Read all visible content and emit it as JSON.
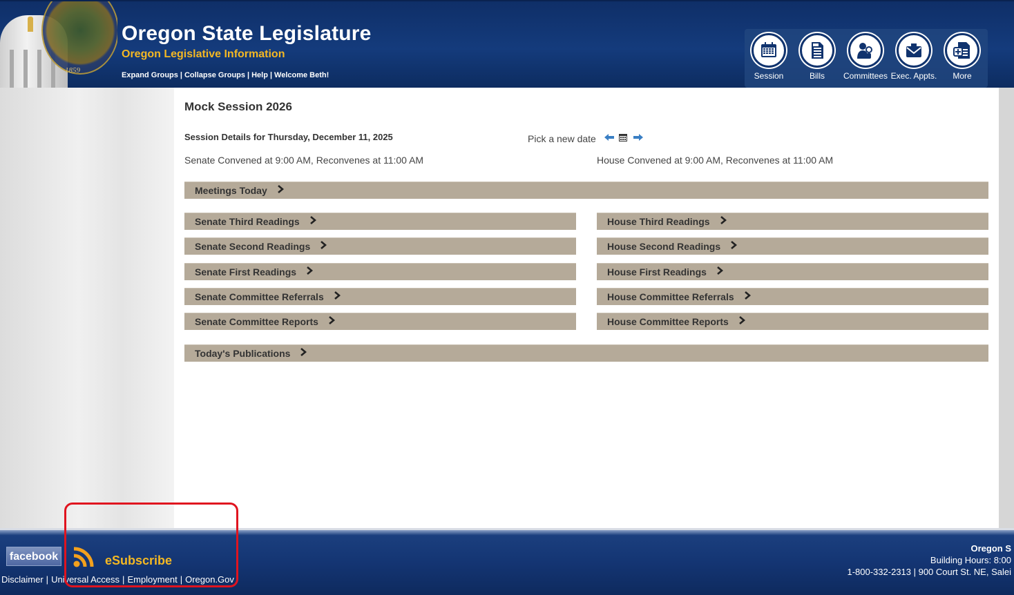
{
  "header": {
    "title": "Oregon State Legislature",
    "subtitle": "Oregon Legislative Information",
    "seal_year": "1859",
    "links": [
      "Expand Groups",
      "Collapse Groups",
      "Help",
      "Welcome Beth!"
    ]
  },
  "nav": [
    {
      "label": "Session",
      "icon": "calendar-icon"
    },
    {
      "label": "Bills",
      "icon": "document-icon"
    },
    {
      "label": "Committees",
      "icon": "committee-icon"
    },
    {
      "label": "Exec. Appts.",
      "icon": "envelope-icon"
    },
    {
      "label": "More",
      "icon": "add-document-icon"
    }
  ],
  "main": {
    "session_title": "Mock Session 2026",
    "details_label": "Session Details for Thursday, December 11, 2025",
    "pick_date": "Pick a new date",
    "senate_convened": "Senate Convened at 9:00 AM, Reconvenes at 11:00 AM",
    "house_convened": "House Convened at 9:00 AM, Reconvenes at 11:00 AM",
    "meetings_today": "Meetings Today",
    "senate_bars": [
      "Senate Third Readings",
      "Senate Second Readings",
      "Senate First Readings",
      "Senate Committee Referrals",
      "Senate Committee Reports"
    ],
    "house_bars": [
      "House Third Readings",
      "House Second Readings",
      "House First Readings",
      "House Committee Referrals",
      "House Committee Reports"
    ],
    "publications": "Today's Publications"
  },
  "footer": {
    "facebook": "facebook",
    "esubscribe": "eSubscribe",
    "links": [
      "Disclaimer",
      "Universal Access",
      "Employment",
      "Oregon.Gov"
    ],
    "org": "Oregon S",
    "hours": "Building Hours: 8:00",
    "address": "1-800-332-2313 | 900 Court St. NE, Salei"
  },
  "colors": {
    "header_bg": "#143b7c",
    "accent_gold": "#f4b823",
    "bar_bg": "#b5aa99",
    "highlight_red": "#e0141f",
    "arrow_blue": "#3a7fc4"
  }
}
